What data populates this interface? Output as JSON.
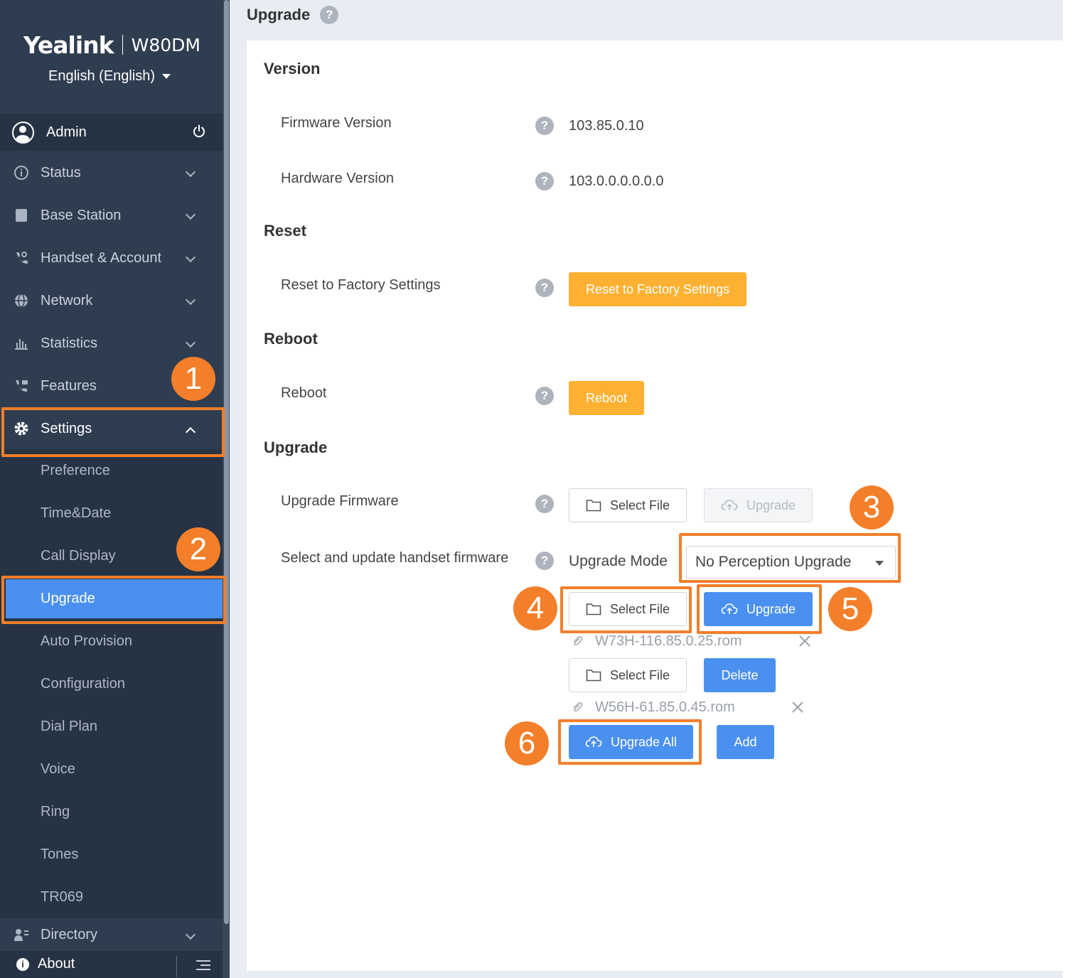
{
  "sidebar": {
    "brand": "Yealink",
    "model": "W80DM",
    "language": "English (English)",
    "user": "Admin",
    "nav": [
      {
        "label": "Status",
        "icon": "info-icon"
      },
      {
        "label": "Base Station",
        "icon": "base-station-icon"
      },
      {
        "label": "Handset & Account",
        "icon": "handset-icon"
      },
      {
        "label": "Network",
        "icon": "globe-icon"
      },
      {
        "label": "Statistics",
        "icon": "bar-chart-icon"
      },
      {
        "label": "Features",
        "icon": "phone-features-icon"
      },
      {
        "label": "Settings",
        "icon": "gear-icon"
      }
    ],
    "settings_sub": [
      "Preference",
      "Time&Date",
      "Call Display",
      "Upgrade",
      "Auto Provision",
      "Configuration",
      "Dial Plan",
      "Voice",
      "Ring",
      "Tones",
      "TR069"
    ],
    "directory": "Directory",
    "about": "About"
  },
  "page": {
    "title": "Upgrade",
    "help_glyph": "?"
  },
  "sections": {
    "version": {
      "title": "Version",
      "firmware_label": "Firmware Version",
      "firmware_value": "103.85.0.10",
      "hardware_label": "Hardware Version",
      "hardware_value": "103.0.0.0.0.0.0"
    },
    "reset": {
      "title": "Reset",
      "label": "Reset to Factory Settings",
      "button": "Reset to Factory Settings"
    },
    "reboot": {
      "title": "Reboot",
      "label": "Reboot",
      "button": "Reboot"
    },
    "upgrade": {
      "title": "Upgrade",
      "firmware_label": "Upgrade Firmware",
      "select_file": "Select File",
      "upgrade_button": "Upgrade",
      "handset_label": "Select and update handset firmware",
      "mode_label": "Upgrade Mode",
      "mode_value": "No Perception Upgrade",
      "files": [
        "W73H-116.85.0.25.rom",
        "W56H-61.85.0.45.rom"
      ],
      "delete_button": "Delete",
      "upgrade_all": "Upgrade All",
      "add_button": "Add"
    }
  },
  "callouts": [
    "1",
    "2",
    "3",
    "4",
    "5",
    "6"
  ],
  "colors": {
    "sidebar_bg": "#2f3d50",
    "accent_blue": "#4a90f0",
    "orange_button": "#fdb132",
    "callout_orange": "#f37f2a",
    "page_bg": "#e8ecf3"
  }
}
